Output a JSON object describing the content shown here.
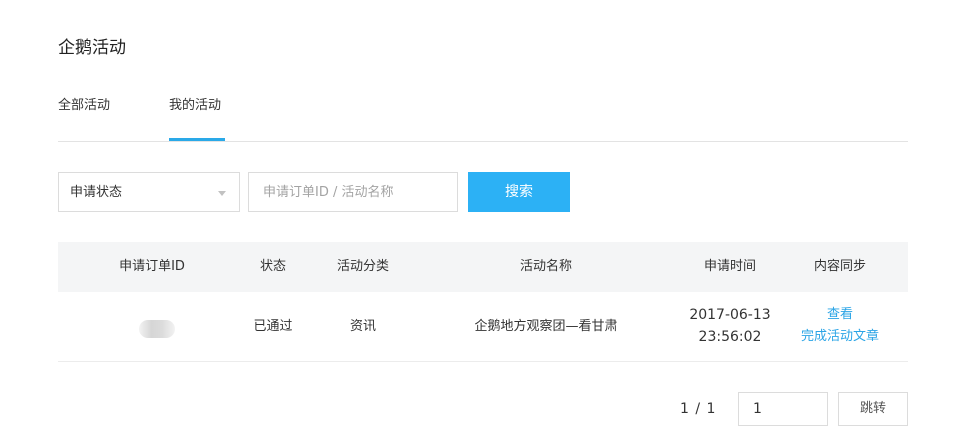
{
  "page": {
    "title": "企鹅活动"
  },
  "tabs": [
    {
      "label": "全部活动",
      "active": false
    },
    {
      "label": "我的活动",
      "active": true
    }
  ],
  "filters": {
    "status_select": {
      "value": "申请状态"
    },
    "search": {
      "placeholder": "申请订单ID / 活动名称",
      "value": ""
    },
    "search_button": "搜索"
  },
  "table": {
    "headers": {
      "order_id": "申请订单ID",
      "status": "状态",
      "category": "活动分类",
      "name": "活动名称",
      "time": "申请时间",
      "sync": "内容同步"
    },
    "rows": [
      {
        "order_id": "",
        "status": "已通过",
        "category": "资讯",
        "name": "企鹅地方观察团—看甘肃",
        "date": "2017-06-13",
        "time": "23:56:02",
        "sync_links": [
          "查看",
          "完成活动文章"
        ]
      }
    ]
  },
  "pagination": {
    "text": "1 / 1",
    "input_value": "1",
    "jump_label": "跳转"
  },
  "colors": {
    "accent": "#2cb1f5",
    "link": "#2aa4e6",
    "header_bg": "#f4f5f6"
  }
}
